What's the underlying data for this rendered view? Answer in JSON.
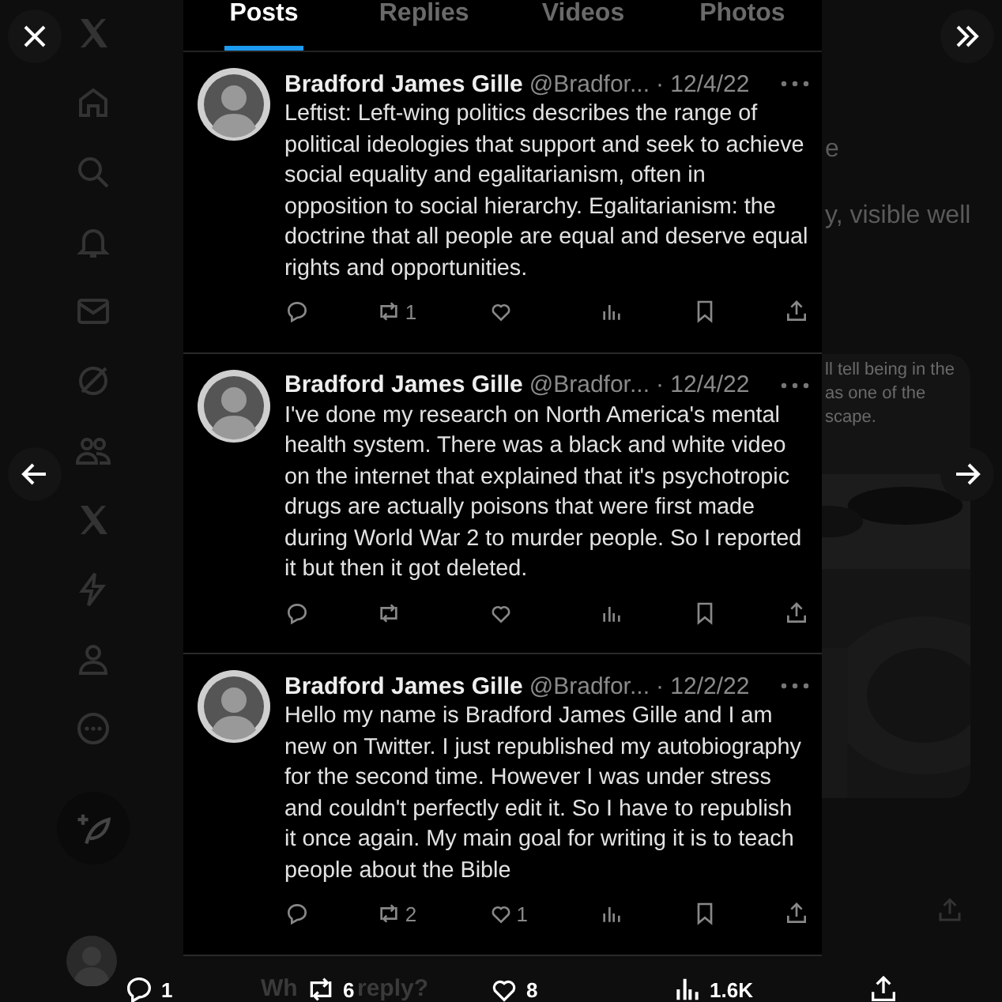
{
  "tabs": [
    {
      "label": "Posts",
      "selected": true
    },
    {
      "label": "Replies",
      "selected": false
    },
    {
      "label": "Videos",
      "selected": false
    },
    {
      "label": "Photos",
      "selected": false
    }
  ],
  "posts": [
    {
      "name": "Bradford James Gille",
      "handle": "@Bradfor...",
      "date": "· 12/4/22",
      "text": "Leftist: Left-wing politics describes the range of political ideologies that support and seek to achieve social equality and egalitarianism, often in opposition to social hierarchy. Egalitarianism: the doctrine that all people are equal and deserve equal rights and opportunities.",
      "reposts": "1"
    },
    {
      "name": "Bradford James Gille",
      "handle": "@Bradfor...",
      "date": "· 12/4/22",
      "text": "I've done my research on North America's mental health system. There was a black and white video on the internet that explained that it's psychotropic drugs are actually poisons that were first made during World War 2 to murder people. So I reported it but then it got deleted."
    },
    {
      "name": "Bradford James Gille",
      "handle": "@Bradfor...",
      "date": "· 12/2/22",
      "text": "Hello my name is Bradford James Gille and I am new on Twitter. I just republished my autobiography for the second time. However I was under stress and couldn't perfectly edit it. So I have to republish it once again. My main goal for writing it is to teach people about the Bible",
      "reposts": "2",
      "likes": "1"
    }
  ],
  "background_fragments": [
    "e",
    "y, visible well",
    "ll tell being in the",
    "as one of the",
    "scape."
  ],
  "reply_prompt": [
    "Wh",
    "reply?"
  ],
  "stats": {
    "replies": "1",
    "reposts": "6",
    "likes": "8",
    "views": "1.6K"
  }
}
